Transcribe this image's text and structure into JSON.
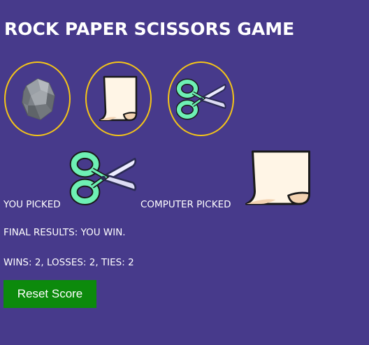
{
  "game": {
    "title": "ROCK PAPER SCISSORS GAME"
  },
  "choices": [
    {
      "name": "rock",
      "icon": "rock-icon"
    },
    {
      "name": "paper",
      "icon": "paper-icon"
    },
    {
      "name": "scissors",
      "icon": "scissors-icon"
    }
  ],
  "picks": {
    "you_label": "YOU PICKED",
    "you_pick": "scissors",
    "computer_label": "COMPUTER PICKED",
    "computer_pick": "paper"
  },
  "results": {
    "final_text": "FINAL RESULTS: YOU WIN.",
    "score_text": "WINS: 2, LOSSES: 2, TIES: 2"
  },
  "score": {
    "wins": 2,
    "losses": 2,
    "ties": 2
  },
  "controls": {
    "reset_label": "Reset Score"
  },
  "colors": {
    "background": "#473a8b",
    "ring": "#f5c518",
    "reset_button": "#0c8a0c",
    "text": "#ffffff"
  }
}
